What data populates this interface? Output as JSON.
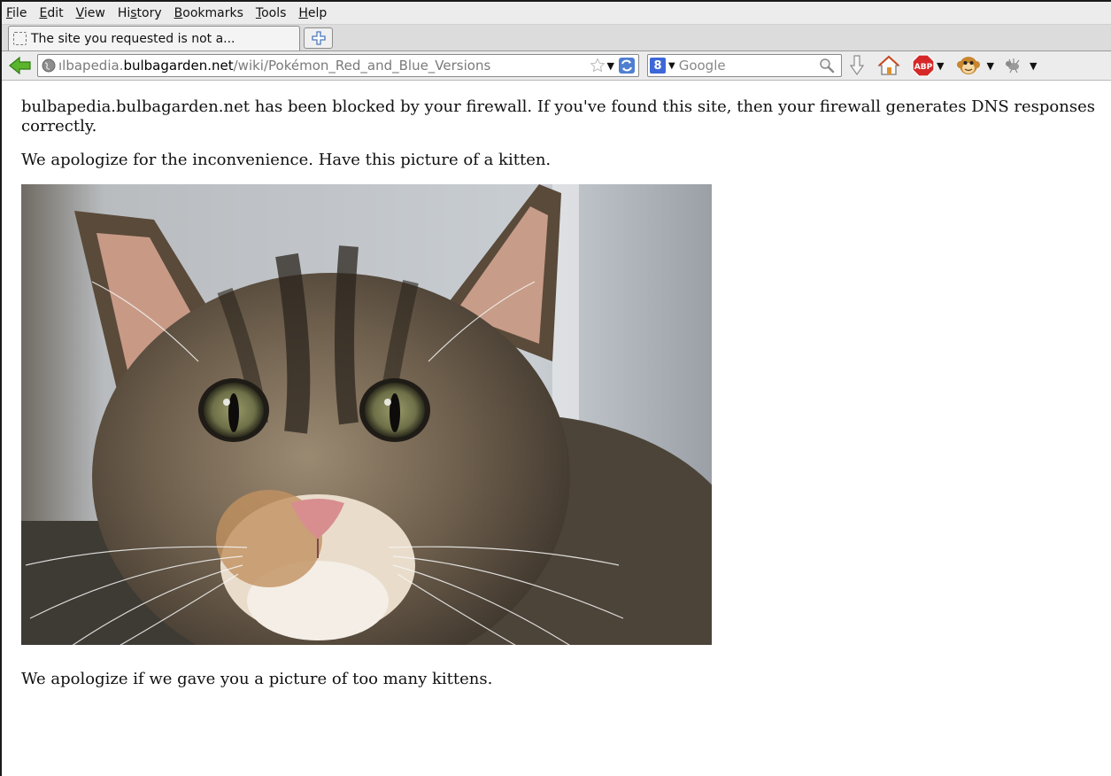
{
  "menubar": {
    "items": [
      {
        "key": "F",
        "rest": "ile"
      },
      {
        "key": "E",
        "rest": "dit"
      },
      {
        "key": "V",
        "rest": "iew"
      },
      {
        "pre": "Hi",
        "key": "s",
        "rest": "tory"
      },
      {
        "key": "B",
        "rest": "ookmarks"
      },
      {
        "key": "T",
        "rest": "ools"
      },
      {
        "key": "H",
        "rest": "elp"
      }
    ]
  },
  "tab": {
    "title": "The site you requested is not a...",
    "favicon": "blank-page-icon",
    "newtab_icon": "plus-icon"
  },
  "urlbar": {
    "prefix": "ılbapedia.",
    "host": "bulbagarden.net",
    "path": "/wiki/Pokémon_Red_and_Blue_Versions",
    "star_icon": "bookmark-star-icon",
    "reload_icon": "reload-icon"
  },
  "searchbar": {
    "engine_letter": "8",
    "placeholder": "Google"
  },
  "toolbar_icons": [
    "back-icon",
    "download-icon",
    "home-icon",
    "adblock-icon",
    "greasemonkey-icon",
    "firebug-icon"
  ],
  "adblock_label": "ABP",
  "colors": {
    "accent": "#3c67d8",
    "back_arrow": "#5bb52c",
    "abp_red": "#d62828"
  },
  "content": {
    "paragraph_1": "bulbapedia.bulbagarden.net has been blocked by your firewall. If you've found this site, then your firewall generates DNS responses correctly.",
    "paragraph_2": "We apologize for the inconvenience. Have this picture of a kitten.",
    "paragraph_3": "We apologize if we gave you a picture of too many kittens."
  }
}
